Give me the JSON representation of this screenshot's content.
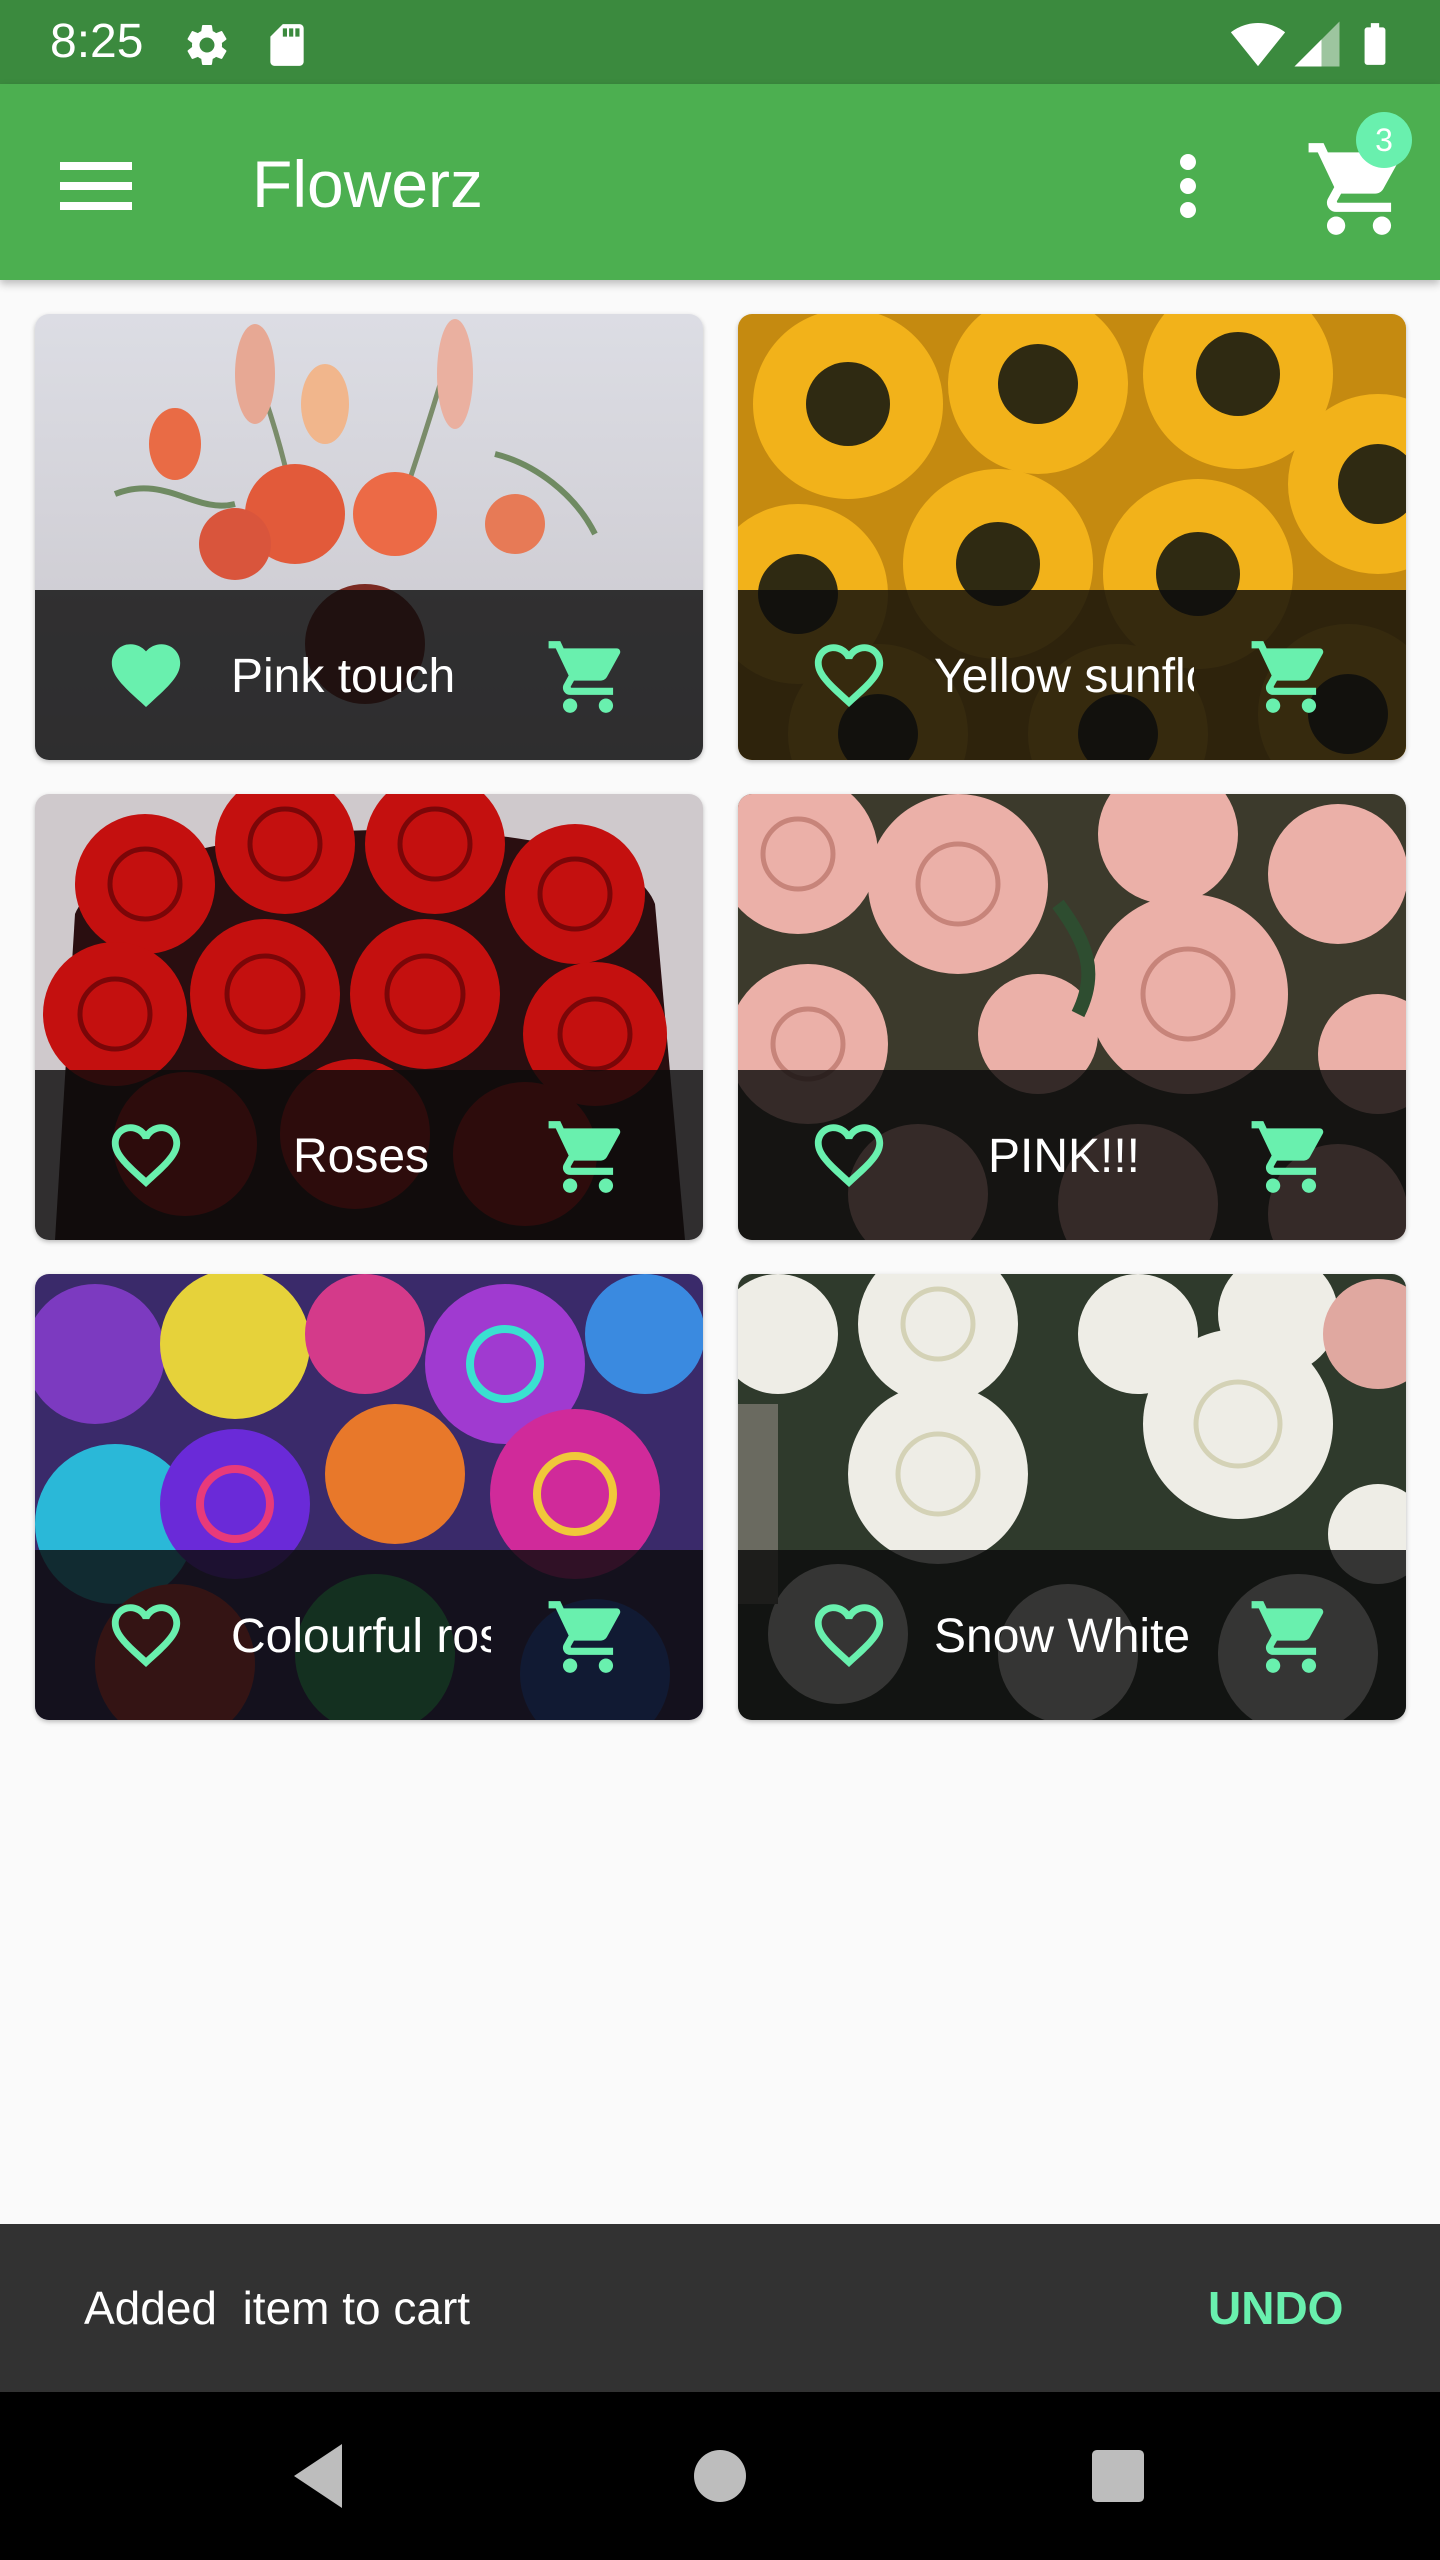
{
  "status_bar": {
    "time": "8:25",
    "icons": [
      "settings-icon",
      "sd-card-icon",
      "wifi-icon",
      "signal-icon",
      "battery-icon"
    ]
  },
  "app_bar": {
    "title": "Flowerz",
    "cart_count": "3",
    "color": "#4caf50",
    "icons": [
      "menu-icon",
      "more-vert-icon",
      "cart-icon"
    ]
  },
  "products": [
    {
      "label": "Pink touch",
      "favorited": true,
      "image": "bouquet"
    },
    {
      "label": "Yellow sunflowers",
      "favorited": false,
      "image": "sunflowers"
    },
    {
      "label": "Roses",
      "favorited": false,
      "image": "red-roses"
    },
    {
      "label": "PINK!!!",
      "favorited": false,
      "image": "pink-roses"
    },
    {
      "label": "Colourful roses",
      "favorited": false,
      "image": "rainbow-roses"
    },
    {
      "label": "Snow White",
      "favorited": false,
      "image": "white-roses"
    }
  ],
  "snackbar": {
    "message": "Added  item to cart",
    "action": "UNDO",
    "action_color": "#69f0ae"
  },
  "nav_bar": {
    "icons": [
      "back-icon",
      "home-icon",
      "recents-icon"
    ]
  },
  "accent_color": "#69f0ae"
}
